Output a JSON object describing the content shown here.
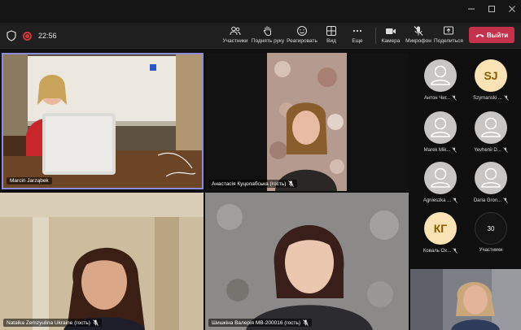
{
  "meeting": {
    "timer": "22:56"
  },
  "toolbar": {
    "participants_label": "Участники",
    "raise_hand_label": "Поднять руку",
    "react_label": "Реагировать",
    "view_label": "Вид",
    "more_label": "Еще",
    "camera_label": "Камера",
    "mic_label": "Микрофон",
    "share_label": "Поделиться",
    "leave_label": "Выйти"
  },
  "tiles": [
    {
      "name": "Marcin Jarząbek"
    },
    {
      "name": "Анастасія Куцолабська (гость)"
    },
    {
      "name": "Natalka Zemzyulina Ukraine (гость)"
    },
    {
      "name": "Шишкіна Валерія МВ-200016 (гость)"
    }
  ],
  "roster": [
    {
      "name": "Антон Чиг...",
      "avatar_type": "generic"
    },
    {
      "name": "Szymanski ...",
      "avatar_type": "initials",
      "initials": "SJ"
    },
    {
      "name": "Marek Mik...",
      "avatar_type": "generic"
    },
    {
      "name": "Yevhenii D...",
      "avatar_type": "generic"
    },
    {
      "name": "Agnieszka ...",
      "avatar_type": "generic"
    },
    {
      "name": "Daria Gron...",
      "avatar_type": "generic"
    },
    {
      "name": "Коваль Ох...",
      "avatar_type": "initials",
      "initials": "КГ"
    },
    {
      "name": "Участники",
      "avatar_type": "count",
      "count": "30"
    }
  ],
  "colors": {
    "leave": "#c4314b",
    "active_speaker_border": "#8e8cd8",
    "recording": "#d13438"
  }
}
